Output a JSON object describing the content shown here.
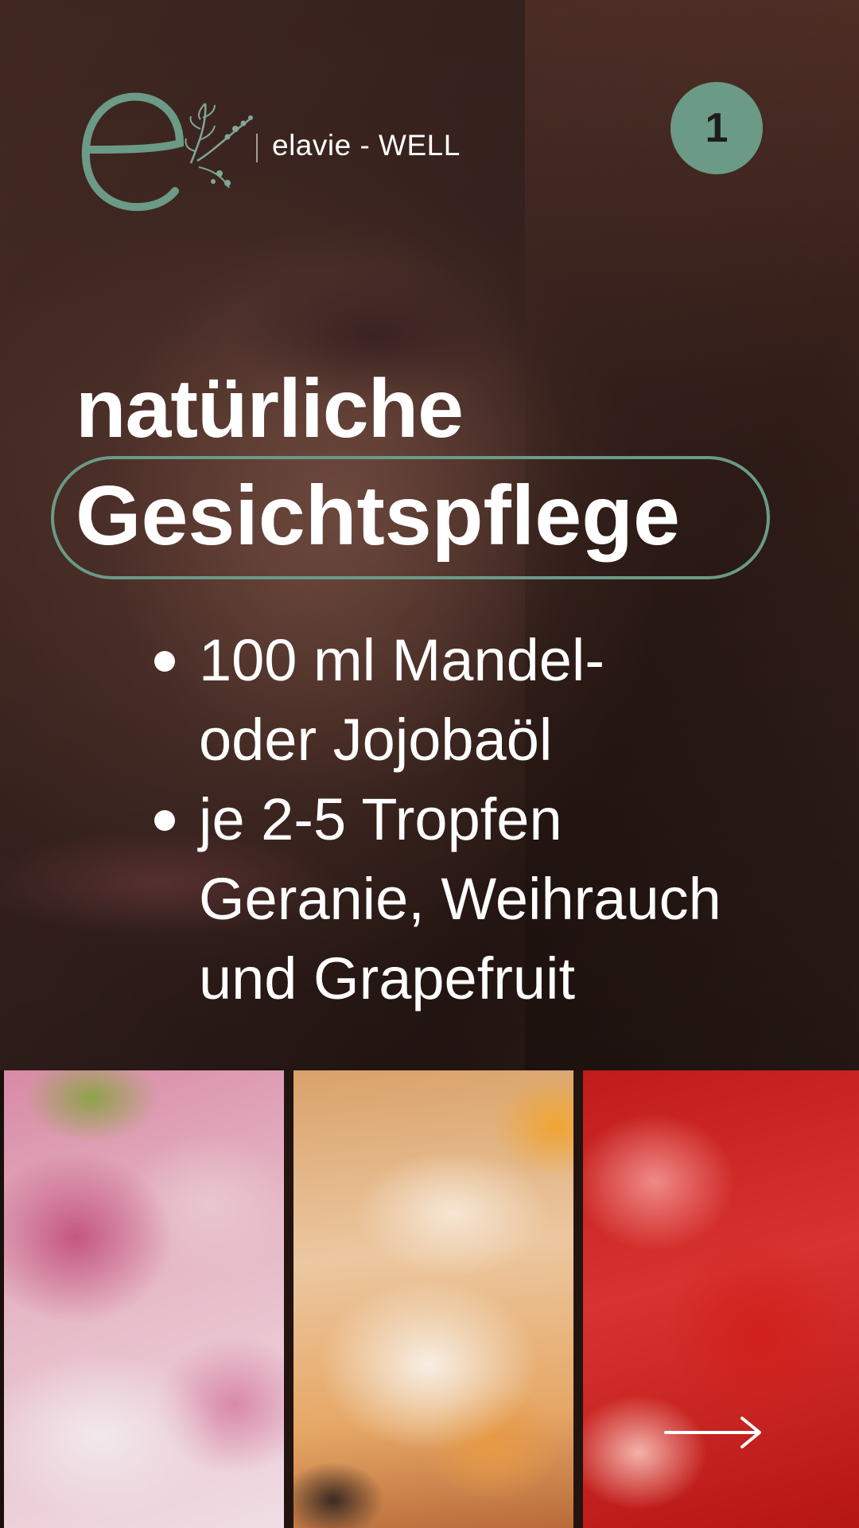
{
  "header": {
    "logo_icon": "elavie-e-leaf-logo",
    "brand_name": "elavie - WELL",
    "page_number": "1"
  },
  "title": {
    "line1": "natürliche",
    "line2": "Gesichtspflege"
  },
  "ingredients": [
    {
      "text": "100 ml Mandel- oder Jojobaöl",
      "line1": "100 ml Mandel-",
      "line2": "oder Jojobaöl"
    },
    {
      "text": "je 2-5 Tropfen Geranie, Weihrauch und Grapefruit",
      "line1": "je 2-5 Tropfen",
      "line2": "Geranie, Weihrauch",
      "line3": "und Grapefruit"
    }
  ],
  "photos": [
    {
      "subject": "geranium flower petals"
    },
    {
      "subject": "frankincense resin"
    },
    {
      "subject": "grapefruit flesh"
    }
  ],
  "navigation": {
    "next_icon": "arrow-right-icon"
  },
  "colors": {
    "accent": "#6b9a87",
    "text": "#ffffff",
    "badge_text": "#1c1c1c"
  }
}
